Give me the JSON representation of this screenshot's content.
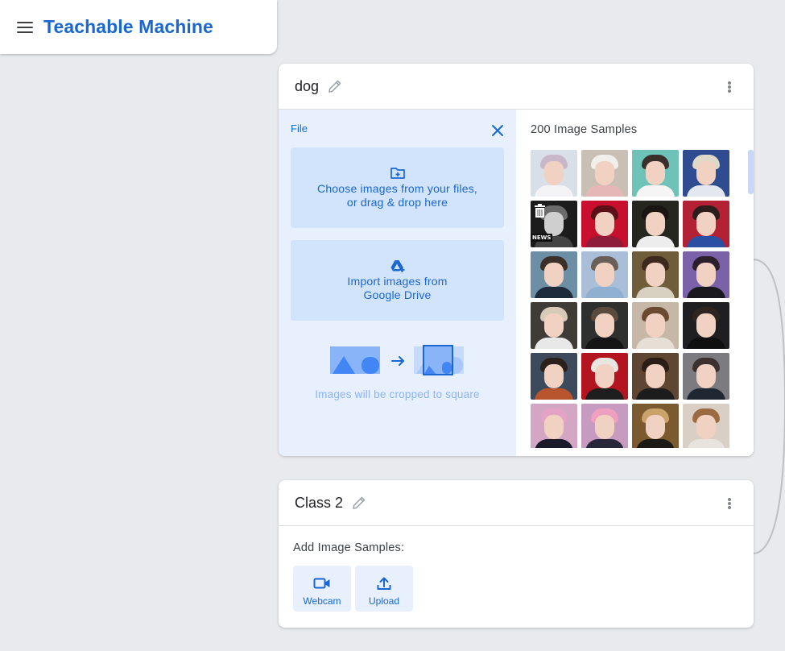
{
  "header": {
    "title": "Teachable Machine"
  },
  "classes": [
    {
      "name": "dog",
      "upload_panel": {
        "label": "File",
        "choose_files_line1": "Choose images from your files,",
        "choose_files_line2": "or drag & drop here",
        "drive_line1": "Import images from",
        "drive_line2": "Google Drive",
        "crop_note": "Images will be cropped to square"
      },
      "samples": {
        "title": "200 Image Samples",
        "news_tag": "NEWS"
      }
    },
    {
      "name": "Class 2",
      "add_label": "Add Image Samples:",
      "webcam_label": "Webcam",
      "upload_label": "Upload"
    }
  ],
  "colors": {
    "accent": "#1967d2",
    "panel_bg": "#e8f0fe",
    "button_bg": "#d2e3fc",
    "page_bg": "#e8eaed"
  },
  "icons": [
    "menu-icon",
    "pencil-icon",
    "more-vert-icon",
    "close-icon",
    "folder-add-icon",
    "google-drive-icon",
    "arrow-right-icon",
    "trash-icon",
    "video-camera-icon",
    "upload-icon"
  ]
}
